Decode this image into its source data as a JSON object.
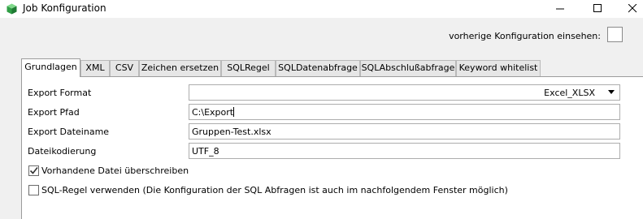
{
  "window": {
    "title": "Job Konfiguration",
    "icon": "app-cube-icon",
    "controls": [
      "minimize-icon",
      "maximize-icon",
      "close-icon"
    ]
  },
  "header": {
    "prev_config_label": "vorherige Konfiguration einsehen:",
    "prev_config_checked": false
  },
  "tabs": [
    {
      "label": "Grundlagen",
      "active": true
    },
    {
      "label": "XML"
    },
    {
      "label": "CSV"
    },
    {
      "label": "Zeichen ersetzen"
    },
    {
      "label": "SQLRegel"
    },
    {
      "label": "SQLDatenabfrage"
    },
    {
      "label": "SQLAbschlußabfrage"
    },
    {
      "label": "Keyword whitelist"
    }
  ],
  "form": {
    "export_format": {
      "label": "Export Format",
      "value": "Excel_XLSX"
    },
    "export_pfad": {
      "label": "Export Pfad",
      "value": "C:\\Export"
    },
    "export_dateiname": {
      "label": "Export Dateiname",
      "value": "Gruppen-Test.xlsx"
    },
    "dateikodierung": {
      "label": "Dateikodierung",
      "value": "UTF_8"
    },
    "overwrite": {
      "label": "Vorhandene Datei überschreiben",
      "checked": true
    },
    "sql_rule": {
      "label": "SQL-Regel verwenden (Die Konfiguration der SQL Abfragen ist auch im nachfolgendem Fenster möglich)",
      "checked": false
    }
  },
  "colors": {
    "window_bg": "#f0f0f0",
    "panel_bg": "#ffffff",
    "border": "#adadad"
  }
}
